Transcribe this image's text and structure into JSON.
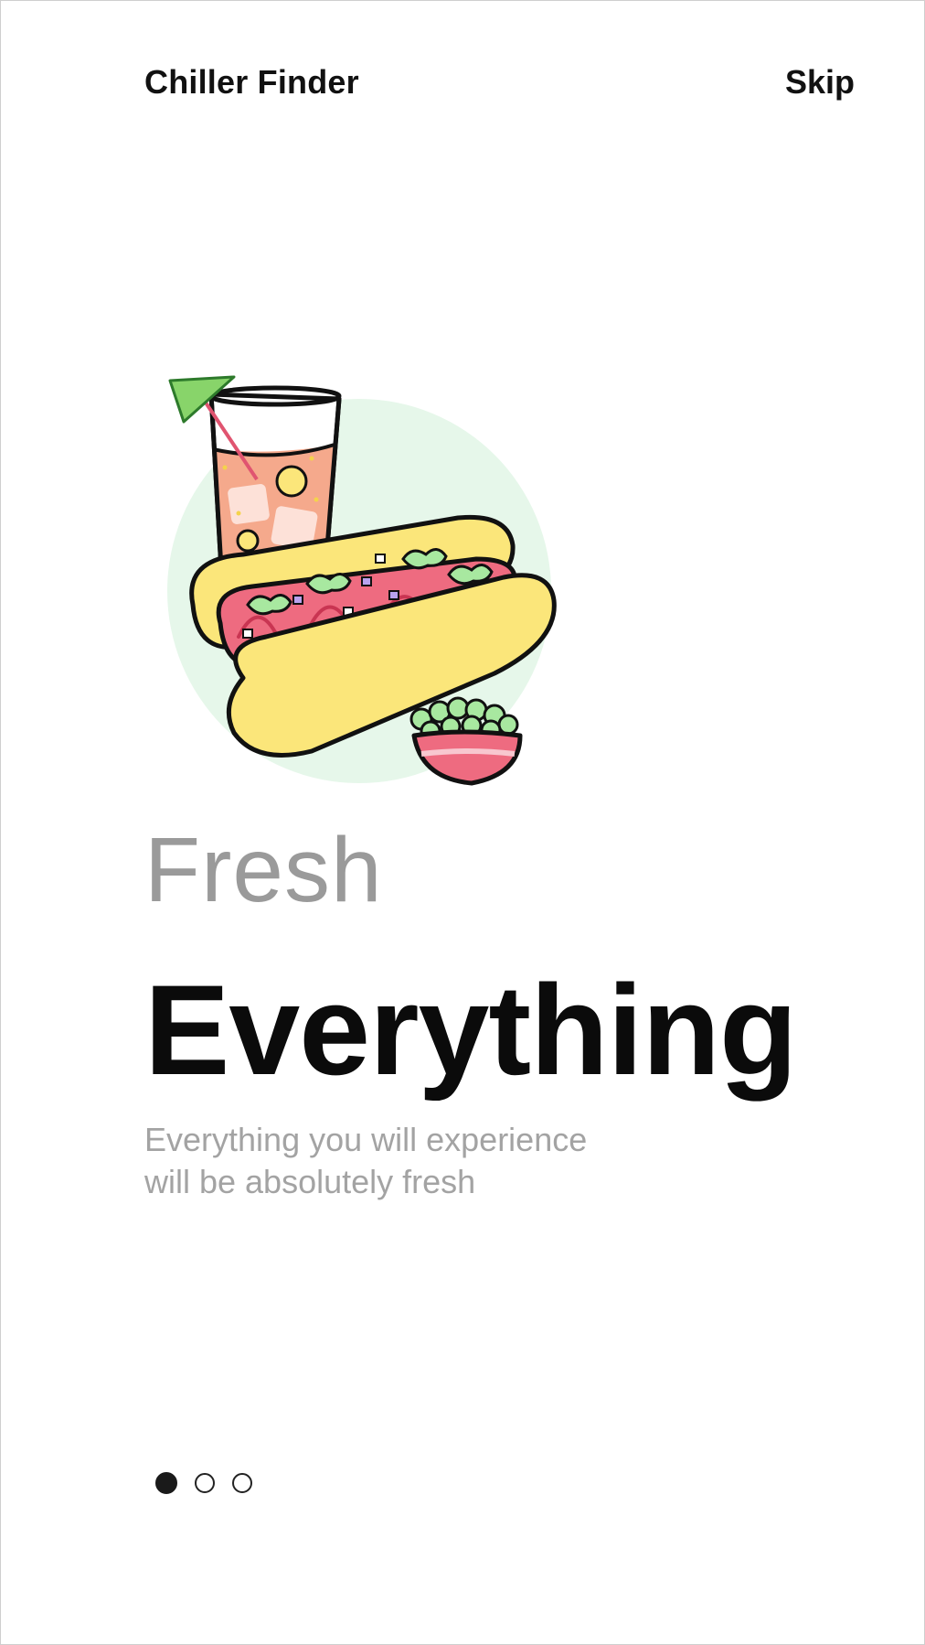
{
  "header": {
    "app_title": "Chiller Finder",
    "skip_label": "Skip"
  },
  "onboarding": {
    "illustration_icon": "hotdog-drink-illustration",
    "subtitle": "Fresh",
    "headline": "Everything",
    "description": "Everything you will experience will be absolutely fresh",
    "page_count": 3,
    "active_page": 1
  },
  "colors": {
    "circle_bg": "#e6f7ea",
    "bun": "#fbe67a",
    "sausage": "#ee6b80",
    "drink": "#f5a98c",
    "lettuce": "#a8e8a0",
    "umbrella": "#88d46a"
  }
}
